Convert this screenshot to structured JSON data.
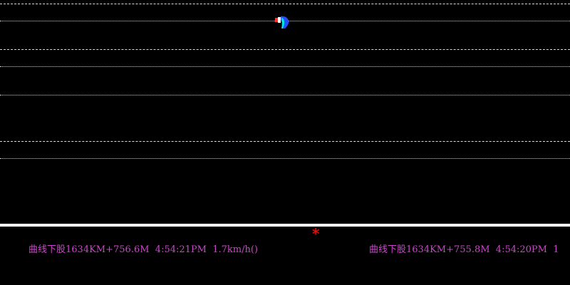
{
  "colors": {
    "background": "#000000",
    "grid": "#d9d9d9",
    "separator": "#ffffff",
    "status_text": "#cc44cc",
    "marker": "#ff0000"
  },
  "plot": {
    "grid_line_count": 8
  },
  "status": {
    "marker_symbol": "*",
    "records": [
      "曲线下股1634KM+756.6M  4:54:21PM  1.7km/h()",
      "曲线下股1634KM+755.8M  4:54:20PM  1"
    ]
  }
}
